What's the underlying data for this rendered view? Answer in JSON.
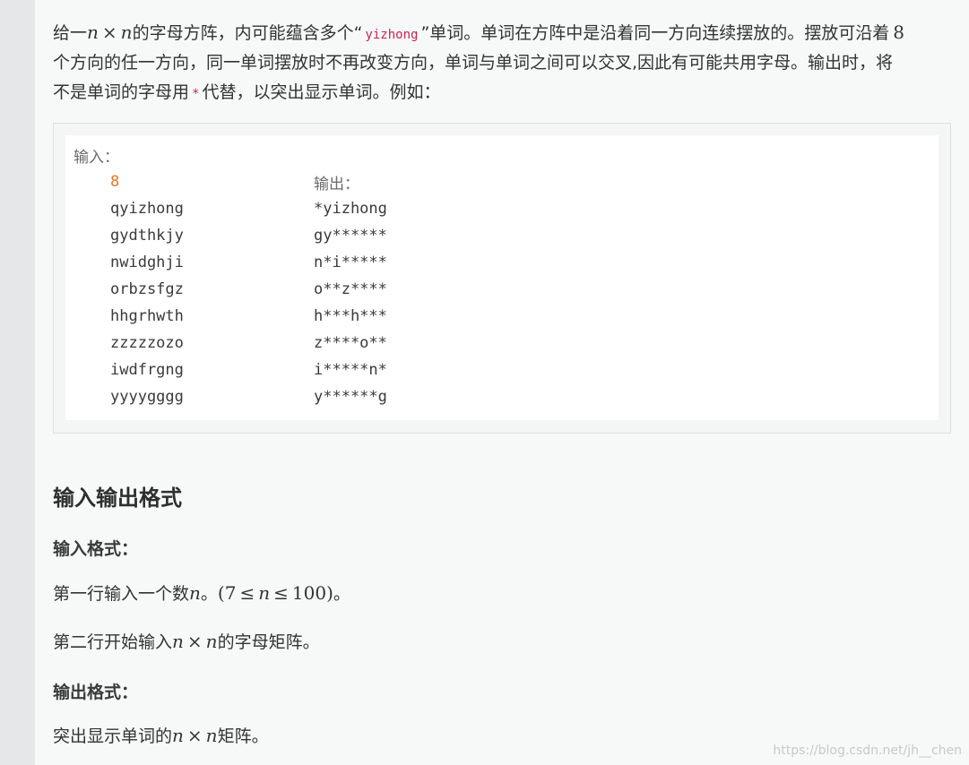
{
  "intro": {
    "line1_a": "给一",
    "math_nxn": {
      "n1": "n",
      "times": "×",
      "n2": "n"
    },
    "line1_b": "的字母方阵，内可能蕴含多个“",
    "word_code": "yizhong",
    "line1_c": "”单词。单词在方阵中是沿着同一方向连续摆放的。摆放可沿着",
    "eight": "8",
    "line2": "个方向的任一方向，同一单词摆放时不再改变方向，单词与单词之间可以交叉,因此有可能共用字母。输出时，将",
    "line3_a": "不是单词的字母用",
    "star_code": "*",
    "line3_b": "代替，以突出显示单词。例如："
  },
  "example": {
    "input_label": "输入：",
    "output_label": "输出：",
    "n_value": "8",
    "input_rows": [
      "qyizhong",
      "gydthkjy",
      "nwidghji",
      "orbzsfgz",
      "hhgrhwth",
      "zzzzzozo",
      "iwdfrgng",
      "yyyygggg"
    ],
    "output_rows": [
      "*yizhong",
      "gy******",
      "n*i*****",
      "o**z****",
      "h***h***",
      "z****o**",
      "i*****n*",
      "y******g"
    ]
  },
  "section_title": "输入输出格式",
  "input_format": {
    "title": "输入格式：",
    "line1_a": "第一行输入一个数",
    "line1_var": "n",
    "line1_b": "。",
    "range": {
      "open": "(",
      "low": "7",
      "le1": "≤",
      "var": "n",
      "le2": "≤",
      "high": "100",
      "close": ")"
    },
    "line1_c": "。",
    "line2_a": "第二行开始输入",
    "line2_b": "的字母矩阵。"
  },
  "output_format": {
    "title": "输出格式：",
    "line_a": "突出显示单词的",
    "line_b": "矩阵。"
  },
  "watermark": "https://blog.csdn.net/jh__chen"
}
